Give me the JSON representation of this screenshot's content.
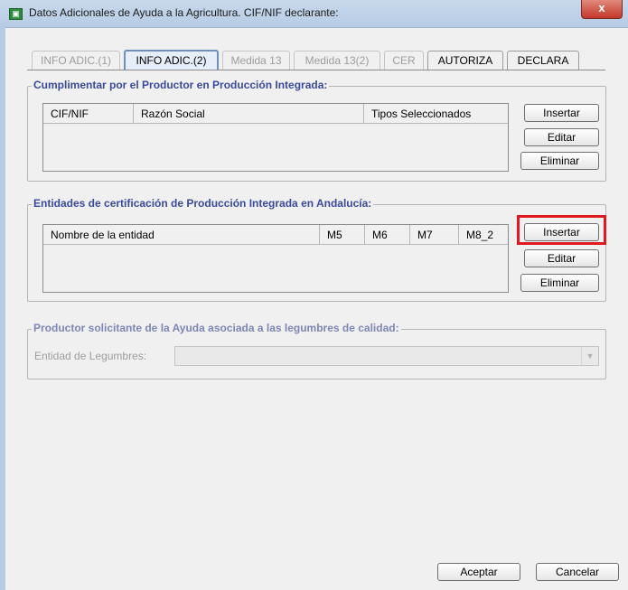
{
  "window": {
    "title": "Datos Adicionales de Ayuda a la Agricultura. CIF/NIF declarante:",
    "close_label": "x"
  },
  "tabs": [
    {
      "label": "INFO ADIC.(1)",
      "state": "disabled"
    },
    {
      "label": "INFO ADIC.(2)",
      "state": "active"
    },
    {
      "label": "Medida 13",
      "state": "disabled"
    },
    {
      "label": "Medida 13(2)",
      "state": "disabled"
    },
    {
      "label": "CER",
      "state": "disabled"
    },
    {
      "label": "AUTORIZA",
      "state": "enabled"
    },
    {
      "label": "DECLARA",
      "state": "enabled"
    }
  ],
  "section1": {
    "title": "Cumplimentar por el Productor en Producción Integrada:",
    "columns": [
      "CIF/NIF",
      "Razón Social",
      "Tipos Seleccionados"
    ],
    "buttons": {
      "insert": "Insertar",
      "edit": "Editar",
      "delete": "Eliminar"
    }
  },
  "section2": {
    "title": "Entidades de certificación de Producción Integrada en Andalucía:",
    "columns": [
      "Nombre de la entidad",
      "M5",
      "M6",
      "M7",
      "M8_2"
    ],
    "buttons": {
      "insert": "Insertar",
      "edit": "Editar",
      "delete": "Eliminar"
    },
    "highlighted": "insert"
  },
  "section3": {
    "title": "Productor solicitante de la Ayuda asociada a las legumbres de calidad:",
    "field_label": "Entidad de Legumbres:",
    "field_value": "",
    "enabled": false
  },
  "footer": {
    "accept": "Aceptar",
    "cancel": "Cancelar"
  },
  "colors": {
    "highlight": "#e0191f",
    "group_title": "#3a4a9a",
    "titlebar": "#c9d9ec"
  }
}
